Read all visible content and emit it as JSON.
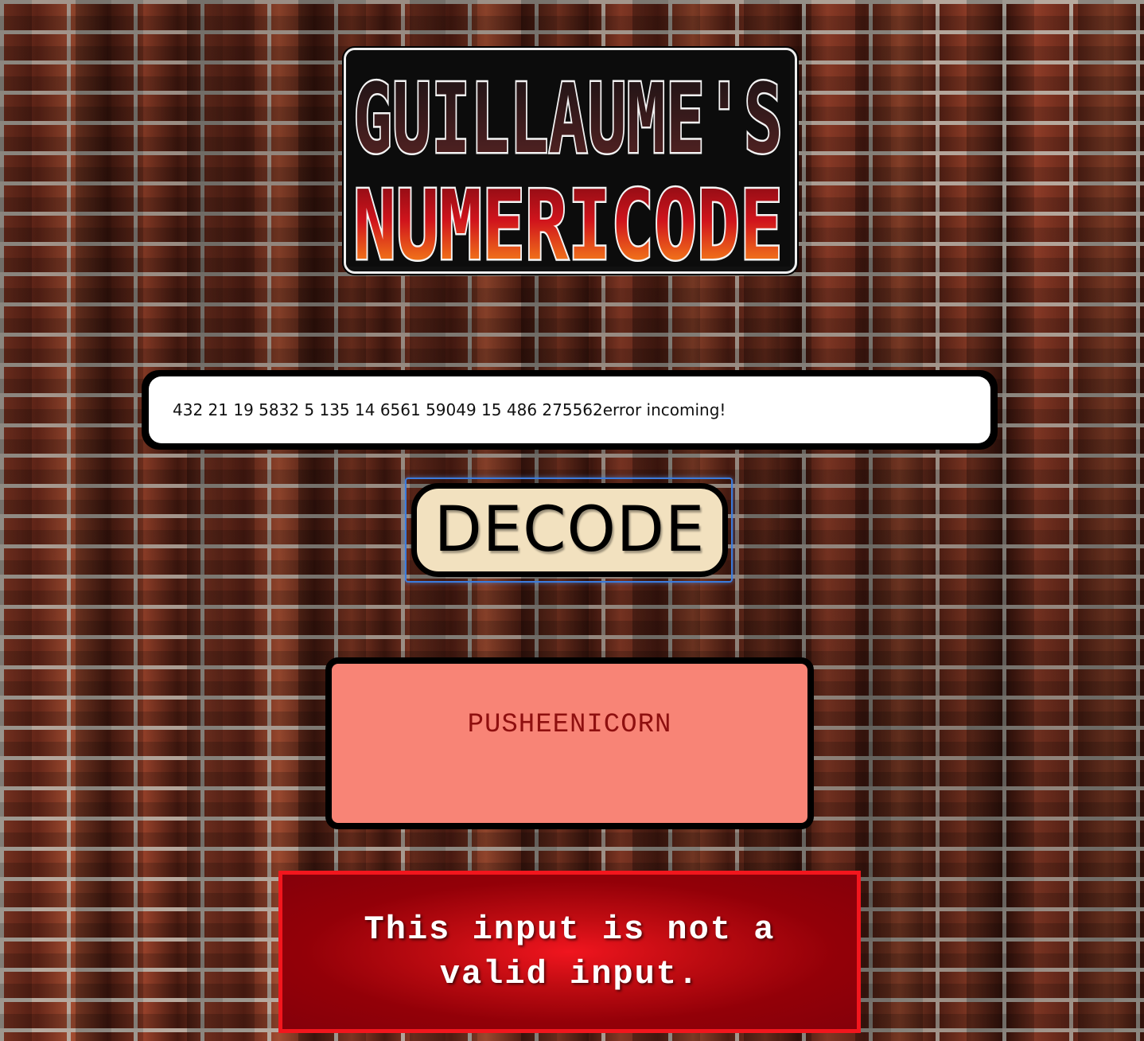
{
  "header": {
    "logo_line1": "GUILLAUME'S",
    "logo_line2": "NUMERICODE"
  },
  "form": {
    "code_input_value": "432 21 19 5832 5 135 14 6561 59049 15 486 275562error incoming!",
    "decode_button_label": "DECODE"
  },
  "result": {
    "text": "PUSHEENICORN"
  },
  "error": {
    "message": "This input is not a valid input."
  },
  "colors": {
    "decode_button_bg": "#f2e1bf",
    "result_bg": "#f88476",
    "result_text": "#8e0f0f",
    "error_bg": "#930008",
    "error_border": "#f2161d"
  }
}
